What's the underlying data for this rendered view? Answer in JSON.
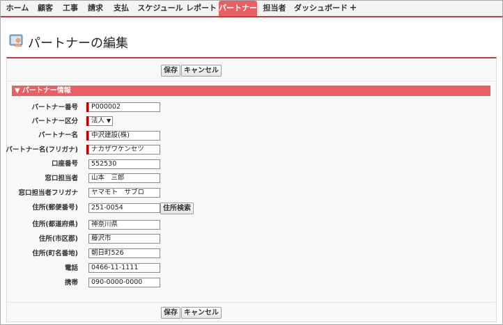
{
  "nav": {
    "tabs": [
      "ホーム",
      "顧客",
      "工事",
      "請求",
      "支払",
      "スケジュール",
      "レポート",
      "パートナー",
      "担当者",
      "ダッシュボード"
    ],
    "active_tab": "パートナー",
    "plus": "+"
  },
  "page": {
    "title": "パートナーの編集"
  },
  "buttons": {
    "save": "保存",
    "cancel": "キャンセル"
  },
  "section": {
    "title": "パートナー情報"
  },
  "fields": {
    "partner_no": {
      "label": "パートナー番号",
      "value": "P000002"
    },
    "partner_type": {
      "label": "パートナー区分",
      "value": "法人"
    },
    "partner_name": {
      "label": "パートナー名",
      "value": "中沢建設(株)"
    },
    "partner_kana": {
      "label": "パートナー名(フリガナ)",
      "value": "ナカザワケンセツ"
    },
    "account_no": {
      "label": "口座番号",
      "value": "552530"
    },
    "contact": {
      "label": "窓口担当者",
      "value": "山本　三郎"
    },
    "contact_kana": {
      "label": "窓口担当者フリガナ",
      "value": "ヤマモト　サブロ"
    },
    "postal": {
      "label": "住所(郵便番号)",
      "value": "251-0054",
      "search_label": "住所検索"
    },
    "prefecture": {
      "label": "住所(都道府県)",
      "value": "神奈川県"
    },
    "city": {
      "label": "住所(市区郡)",
      "value": "藤沢市"
    },
    "street": {
      "label": "住所(町名番地)",
      "value": "朝日町526"
    },
    "phone": {
      "label": "電話",
      "value": "0466-11-1111"
    },
    "mobile": {
      "label": "携帯",
      "value": "090-0000-0000"
    }
  },
  "colors": {
    "accent": "#ea5f62",
    "nav_border": "#c43a3f",
    "required": "#c00000"
  }
}
